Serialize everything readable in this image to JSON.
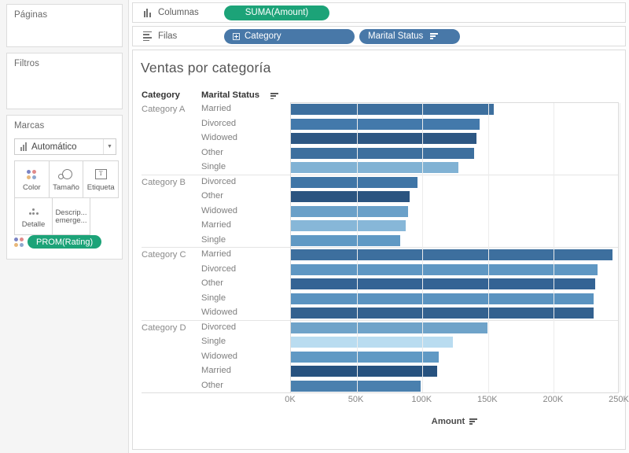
{
  "left_panel": {
    "pages_title": "Páginas",
    "filters_title": "Filtros",
    "marks_title": "Marcas",
    "mark_type": "Automático",
    "mark_type_icon": "bar-chart-icon",
    "mark_buttons": [
      {
        "label": "Color",
        "icon": "color-dots-icon"
      },
      {
        "label": "Tamaño",
        "icon": "size-circles-icon"
      },
      {
        "label": "Etiqueta",
        "icon": "label-text-icon"
      },
      {
        "label": "Detalle",
        "icon": "detail-dots-icon"
      },
      {
        "label": "Descrip... emerge...",
        "icon": "tooltip-icon"
      }
    ],
    "marks_pill": "PROM(Rating)",
    "marks_pill_color": "#1ca378"
  },
  "shelves": {
    "columns": {
      "label": "Columnas",
      "icon": "columns-icon",
      "pills": [
        {
          "text": "SUMA(Amount)",
          "color": "#1ca378",
          "type": "measure"
        }
      ]
    },
    "rows": {
      "label": "Filas",
      "icon": "rows-icon",
      "pills": [
        {
          "text": "Category",
          "color": "#4878a8",
          "type": "dimension",
          "expand_icon": "plus-box-icon"
        },
        {
          "text": "Marital Status",
          "color": "#4878a8",
          "type": "dimension",
          "sort_icon": "sort-icon"
        }
      ]
    }
  },
  "viz": {
    "title": "Ventas por categoría",
    "header_category": "Category",
    "header_marital": "Marital Status",
    "header_sort_icon": "sort-icon",
    "axis_title": "Amount",
    "axis_title_sort_icon": "sort-icon"
  },
  "chart_data": {
    "type": "bar",
    "title": "Ventas por categoría",
    "xlabel": "Amount",
    "ylabel": "",
    "orientation": "horizontal",
    "xlim": [
      0,
      250000
    ],
    "xticks": [
      0,
      50000,
      100000,
      150000,
      200000,
      250000
    ],
    "xtick_labels": [
      "0K",
      "50K",
      "100K",
      "150K",
      "200K",
      "250K"
    ],
    "grid": true,
    "legend": "none",
    "color_encoding": "PROM(Rating)",
    "row_dimensions": [
      "Category",
      "Marital Status"
    ],
    "measure": "SUMA(Amount)",
    "groups": [
      {
        "category": "Category A",
        "rows": [
          {
            "label": "Married",
            "value": 155000,
            "color": "#3d6f9e"
          },
          {
            "label": "Divorced",
            "value": 144000,
            "color": "#4379ab"
          },
          {
            "label": "Widowed",
            "value": 142000,
            "color": "#2d5783"
          },
          {
            "label": "Other",
            "value": 140000,
            "color": "#3d6f9e"
          },
          {
            "label": "Single",
            "value": 128000,
            "color": "#81b2d4"
          }
        ]
      },
      {
        "category": "Category B",
        "rows": [
          {
            "label": "Divorced",
            "value": 97000,
            "color": "#3f75a6"
          },
          {
            "label": "Other",
            "value": 91000,
            "color": "#2b5480"
          },
          {
            "label": "Widowed",
            "value": 90000,
            "color": "#6aa0c8"
          },
          {
            "label": "Married",
            "value": 88000,
            "color": "#87b7d8"
          },
          {
            "label": "Single",
            "value": 84000,
            "color": "#6099c4"
          }
        ]
      },
      {
        "category": "Category C",
        "rows": [
          {
            "label": "Married",
            "value": 245000,
            "color": "#3d6f9e"
          },
          {
            "label": "Divorced",
            "value": 234000,
            "color": "#5f97c3"
          },
          {
            "label": "Other",
            "value": 232000,
            "color": "#346394"
          },
          {
            "label": "Single",
            "value": 231000,
            "color": "#5a93c0"
          },
          {
            "label": "Widowed",
            "value": 231000,
            "color": "#33618f"
          }
        ]
      },
      {
        "category": "Category D",
        "rows": [
          {
            "label": "Divorced",
            "value": 150000,
            "color": "#6fa3c9"
          },
          {
            "label": "Single",
            "value": 124000,
            "color": "#b9dcf0"
          },
          {
            "label": "Widowed",
            "value": 113000,
            "color": "#6099c4"
          },
          {
            "label": "Married",
            "value": 112000,
            "color": "#27527f"
          },
          {
            "label": "Other",
            "value": 99000,
            "color": "#4a80ae"
          }
        ]
      }
    ]
  }
}
